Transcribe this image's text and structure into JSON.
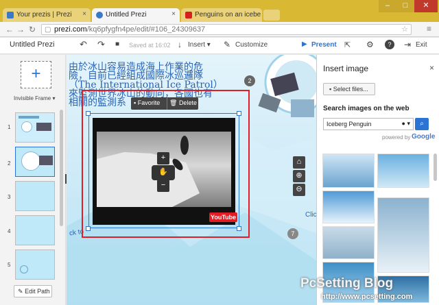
{
  "browser": {
    "tabs": [
      {
        "title": "Your prezis | Prezi",
        "active": false
      },
      {
        "title": "Untitled Prezi",
        "active": true
      },
      {
        "title": "Penguins on an icebe",
        "active": false
      }
    ],
    "url_domain": "prezi.com",
    "url_path": "/kq6pfygfn4pe/edit/#106_24309637"
  },
  "toolbar": {
    "title": "Untitled Prezi",
    "saved": "Saved at 16:02",
    "insert": "Insert",
    "customize": "Customize",
    "present": "Present",
    "exit": "Exit"
  },
  "sidebar": {
    "frame_label": "Invisible Frame",
    "slides": [
      "1",
      "2",
      "3",
      "4",
      "5"
    ],
    "edit_path": "Edit Path"
  },
  "canvas": {
    "chinese_lines": [
      "由於冰山容易造成海上作業的危",
      "險，目前已經組成國際冰巡邏隊",
      "（The International Ice Patrol）",
      "來監測世界冰山的動向，各國也有",
      "相關的監測系"
    ],
    "step_label": "2",
    "step_label_2": "7",
    "favorite": "Favorite",
    "delete": "Delete",
    "video_logo": "YouTube",
    "click_text": "Clic",
    "ck_text": "ck to"
  },
  "panel": {
    "title": "Insert image",
    "select_files": "Select files...",
    "search_heading": "Search images on the web",
    "search_value": "Iceberg Penguin",
    "powered_by": "powered by",
    "google": "Google"
  },
  "watermark": {
    "title": "PcSetting Blog",
    "url": "http://www.pcsetting.com"
  },
  "colors": {
    "titlebar": "#d9b833",
    "accent": "#2a74d6",
    "highlight": "#e01c24"
  }
}
